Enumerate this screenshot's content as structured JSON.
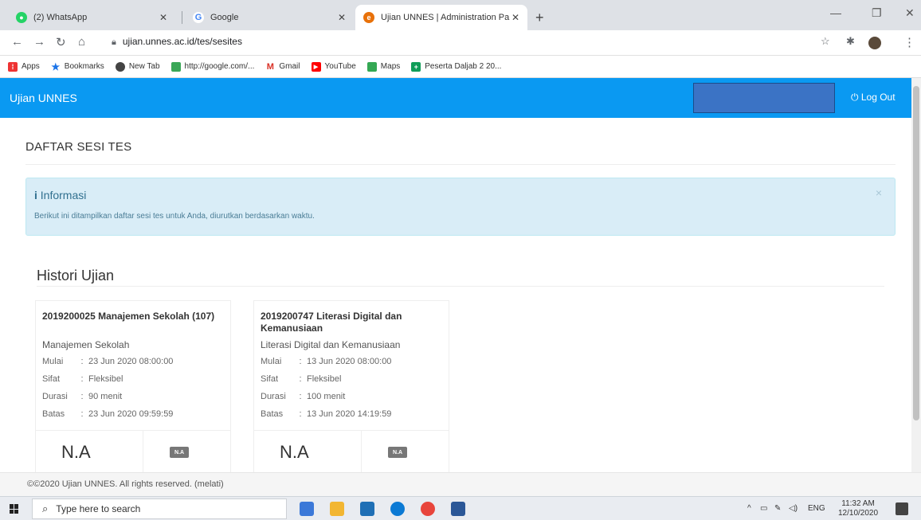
{
  "browser": {
    "tabs": [
      {
        "title": "(2) WhatsApp",
        "icon": "whatsapp-icon",
        "color": "#25d366"
      },
      {
        "title": "Google",
        "icon": "google-icon",
        "color": "#4285f4"
      },
      {
        "title": "Ujian UNNES | Administration Pa",
        "icon": "unnes-icon",
        "color": "#e8710a"
      }
    ],
    "new_tab_symbol": "+",
    "window_controls": [
      "—",
      "❐",
      "✕"
    ],
    "url": "ujian.unnes.ac.id/tes/sesites",
    "bookmarks": [
      {
        "label": "Apps",
        "icon": "apps-grid-icon",
        "color": "#e33"
      },
      {
        "label": "Bookmarks",
        "icon": "star-icon",
        "color": "#1a73e8"
      },
      {
        "label": "New Tab",
        "icon": "chrome-icon",
        "color": "#444"
      },
      {
        "label": "http://google.com/...",
        "icon": "green-square-icon",
        "color": "#3aa757"
      },
      {
        "label": "Gmail",
        "icon": "gmail-icon",
        "color": "#d93025"
      },
      {
        "label": "YouTube",
        "icon": "youtube-icon",
        "color": "#ff0000"
      },
      {
        "label": "Maps",
        "icon": "maps-icon",
        "color": "#34a853"
      },
      {
        "label": "Peserta Daljab 2 20...",
        "icon": "sheets-icon",
        "color": "#0f9d58"
      }
    ]
  },
  "appbar": {
    "brand": "Ujian UNNES",
    "logout": "Log Out",
    "accent": "#0a99f2"
  },
  "page": {
    "title": "DAFTAR SESI TES",
    "alert": {
      "icon": "info-icon",
      "heading": "Informasi",
      "body": "Berikut ini ditampilkan daftar sesi tes untuk Anda, diurutkan berdasarkan waktu.",
      "close": "×"
    },
    "history_title": "Histori Ujian",
    "cards": [
      {
        "title": "2019200025 Manajemen Sekolah (107)",
        "subtitle": "Manajemen Sekolah",
        "rows": [
          {
            "k": "Mulai",
            "v": "23 Jun 2020 08:00:00"
          },
          {
            "k": "Sifat",
            "v": "Fleksibel"
          },
          {
            "k": "Durasi",
            "v": "90 menit"
          },
          {
            "k": "Batas",
            "v": "23 Jun 2020 09:59:59"
          }
        ],
        "score": "N.A",
        "badge": "N.A"
      },
      {
        "title": "2019200747 Literasi Digital dan Kemanusiaan",
        "subtitle": "Literasi Digital dan Kemanusiaan",
        "rows": [
          {
            "k": "Mulai",
            "v": "13 Jun 2020 08:00:00"
          },
          {
            "k": "Sifat",
            "v": "Fleksibel"
          },
          {
            "k": "Durasi",
            "v": "100 menit"
          },
          {
            "k": "Batas",
            "v": "13 Jun 2020 14:19:59"
          }
        ],
        "score": "N.A",
        "badge": "N.A"
      }
    ],
    "footer": "©©2020 Ujian UNNES. All rights reserved. (melati)"
  },
  "taskbar": {
    "search_placeholder": "Type here to search",
    "lang": "ENG",
    "time": "11:32 AM",
    "date": "12/10/2020"
  }
}
